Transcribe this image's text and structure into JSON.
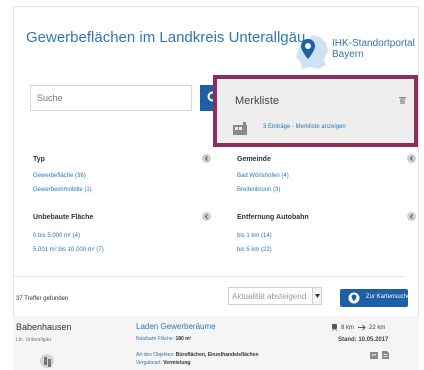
{
  "header": {
    "title": "Gewerbeflächen im Landkreis Unterallgäu",
    "logo_line1": "IHK-Standortportal",
    "logo_line2": "Bayern"
  },
  "search": {
    "placeholder": "Suche"
  },
  "merkliste": {
    "title": "Merkliste",
    "link": "3 Einträge - Merkliste anzeigen"
  },
  "facets": {
    "typ": {
      "heading": "Typ",
      "items": [
        "Gewerbefläche (36)",
        "Gewerbeimmobilie (1)"
      ]
    },
    "gemeinde": {
      "heading": "Gemeinde",
      "items": [
        "Bad Wörishofen (4)",
        "Breitenbrunn (3)"
      ]
    },
    "unbebaute": {
      "heading": "Unbebaute Fläche",
      "items": [
        "0 bis 5.000 m² (4)",
        "5.001 m² bis 10.000 m² (7)"
      ]
    },
    "autobahn": {
      "heading": "Entfernung Autobahn",
      "items": [
        "bis 1 km (14)",
        "bis 5 km (22)"
      ]
    }
  },
  "results": {
    "count": "37 Treffer gefunden",
    "sort_selected": "Aktualität absteigend",
    "map_button": "Zur Kartensuche",
    "item": {
      "city": "Babenhausen",
      "region": "Lkr. Unterallgäu",
      "title": "Laden Gewerberäume",
      "area_label": "Nutzbare Fläche:",
      "area_value": "180 m²",
      "type_label": "Art des Objektes:",
      "type_value": "Büroflächen, Einzelhandelsflächen",
      "contract_label": "Vergabeart:",
      "contract_value": "Vermietung",
      "dist_rail": "8 km",
      "dist_road": "22 km",
      "stand": "Stand: 10.05.2017"
    }
  },
  "colors": {
    "accent": "#1f5fa5",
    "link": "#2e77b5",
    "highlight_border": "#8c2d5d"
  }
}
